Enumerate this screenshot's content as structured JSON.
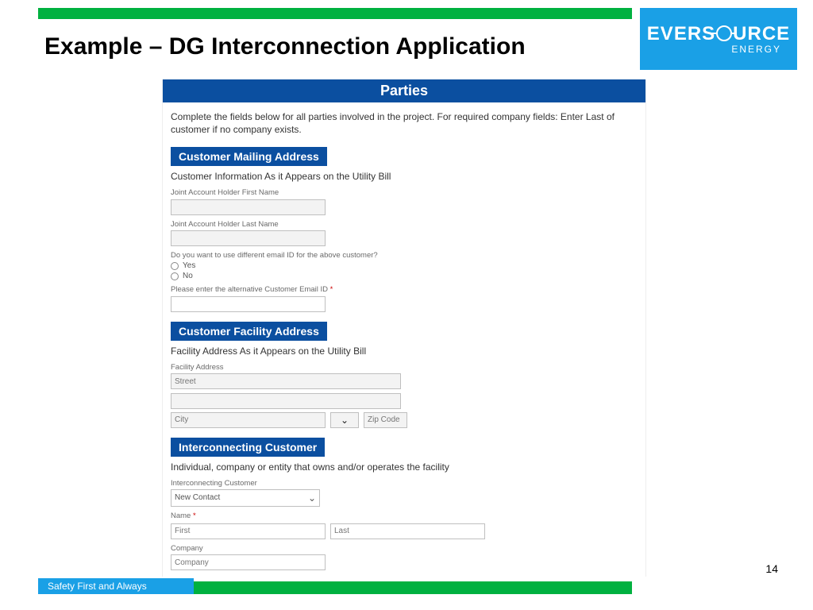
{
  "brand": {
    "name_a": "EVERS",
    "name_b": "URCE",
    "sub": "ENERGY"
  },
  "title": "Example – DG Interconnection Application",
  "parties": {
    "banner": "Parties",
    "instructions": "Complete the fields below for all parties involved in the project. For required company fields: Enter Last of customer if no company exists."
  },
  "mailing": {
    "header": "Customer Mailing Address",
    "note": "Customer Information As it Appears on the Utility Bill",
    "fn_label": "Joint Account Holder First Name",
    "ln_label": "Joint Account Holder Last Name",
    "email_q": "Do you want to use different email ID for the above customer?",
    "yes": "Yes",
    "no": "No",
    "alt_email_label": "Please enter the alternative Customer Email ID",
    "asterisk": "*"
  },
  "facility": {
    "header": "Customer Facility Address",
    "note": "Facility Address As it Appears on the Utility Bill",
    "addr_label": "Facility Address",
    "street_ph": "Street",
    "city_ph": "City",
    "zip_ph": "Zip Code"
  },
  "inter": {
    "header": "Interconnecting Customer",
    "note": "Individual, company or entity that owns and/or operates the facility",
    "cust_label": "Interconnecting Customer",
    "cust_value": "New Contact",
    "name_label": "Name",
    "first_ph": "First",
    "last_ph": "Last",
    "company_label": "Company",
    "company_ph": "Company",
    "asterisk": "*"
  },
  "footer": {
    "tagline": "Safety First and Always",
    "page": "14"
  }
}
